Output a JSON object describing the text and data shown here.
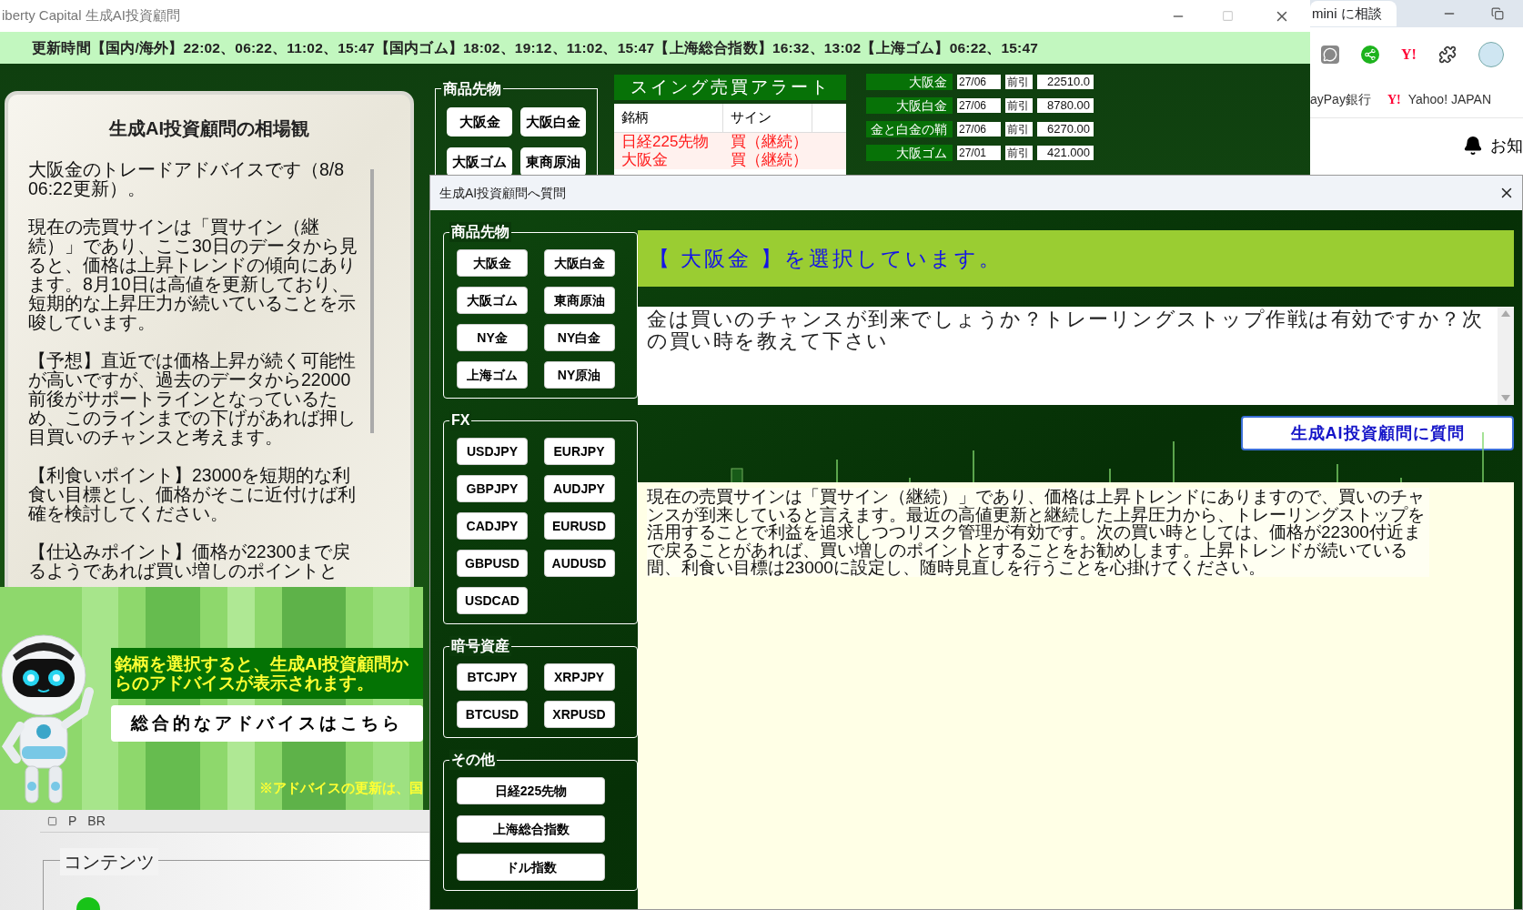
{
  "main_window": {
    "title": "iberty Capital 生成AI投資顧問",
    "update_bar": "更新時間【国内/海外】22:02、06:22、11:02、15:47【国内ゴム】18:02、19:12、11:02、15:47【上海総合指数】16:32、13:02【上海ゴム】06:22、15:47",
    "outlook": {
      "title": "生成AI投資顧問の相場観",
      "paragraphs": [
        "大阪金のトレードアドバイスです（8/8 06:22更新）。",
        "現在の売買サインは「買サイン（継続）」であり、ここ30日のデータから見ると、価格は上昇トレンドの傾向にあります。8月10日は高値を更新しており、短期的な上昇圧力が続いていることを示唆しています。",
        "【予想】直近では価格上昇が続く可能性が高いですが、過去のデータから22000前後がサポートラインとなっているため、このラインまでの下げがあれば押し目買いのチャンスと考えます。",
        "【利食いポイント】23000を短期的な利食い目標とし、価格がそこに近付けば利確を検討してください。",
        "【仕込みポイント】価格が22300まで戻るようであれば買い増しのポイントと"
      ]
    },
    "futures_group": {
      "legend": "商品先物",
      "buttons": [
        "大阪金",
        "大阪白金",
        "大阪ゴム",
        "東商原油"
      ]
    },
    "swing_alert": {
      "title": "スイング売買アラート",
      "columns": [
        "銘柄",
        "サイン"
      ],
      "rows": [
        {
          "name": "日経225先物",
          "sign": "買（継続）"
        },
        {
          "name": "大阪金",
          "sign": "買（継続）"
        }
      ]
    },
    "prices": [
      {
        "name": "大阪金",
        "date": "27/06",
        "session": "前引",
        "value": "22510.0"
      },
      {
        "name": "大阪白金",
        "date": "27/06",
        "session": "前引",
        "value": "8780.00"
      },
      {
        "name": "金と白金の鞘",
        "date": "27/06",
        "session": "前引",
        "value": "6270.00"
      },
      {
        "name": "大阪ゴム",
        "date": "27/01",
        "session": "前引",
        "value": "421.000"
      }
    ],
    "robot_message": "銘柄を選択すると、生成AI投資顧問からのアドバイスが表示されます。",
    "overall_button": "総合的なアドバイスはこちら",
    "note": "※アドバイスの更新は、国"
  },
  "dialog": {
    "title": "生成AI投資顧問へ質問",
    "groups": [
      {
        "legend": "商品先物",
        "kind": "grid",
        "buttons": [
          "大阪金",
          "大阪白金",
          "大阪ゴム",
          "東商原油",
          "NY金",
          "NY白金",
          "上海ゴム",
          "NY原油"
        ]
      },
      {
        "legend": "FX",
        "kind": "grid",
        "buttons": [
          "USDJPY",
          "EURJPY",
          "GBPJPY",
          "AUDJPY",
          "CADJPY",
          "EURUSD",
          "GBPUSD",
          "AUDUSD",
          "USDCAD"
        ]
      },
      {
        "legend": "暗号資産",
        "kind": "grid",
        "buttons": [
          "BTCJPY",
          "XRPJPY",
          "BTCUSD",
          "XRPUSD"
        ]
      },
      {
        "legend": "その他",
        "kind": "wide",
        "buttons": [
          "日経225先物",
          "上海総合指数",
          "ドル指数"
        ]
      }
    ],
    "selected_banner": "【 大阪金 】を選択しています。",
    "question": "金は買いのチャンスが到来でしょうか？トレーリングストップ作戦は有効ですか？次の買い時を教えて下さい",
    "ask_button": "生成AI投資顧問に質問",
    "answer": "現在の売買サインは「買サイン（継続）」であり、価格は上昇トレンドにありますので、買いのチャンスが到来していると言えます。最近の高値更新と継続した上昇圧力から、トレーリングストップを活用することで利益を追求しつつリスク管理が有効です。次の買い時としては、価格が22300付近まで戻ることがあれば、買い増しのポイントとすることをお勧めします。上昇トレンドが続いている間、利食い目標は23000に設定し、随時見直しを行うことを心掛けてください。"
  },
  "browser": {
    "tab": "mini に相談",
    "toolbar_logo": "Y!",
    "bookmarks": [
      {
        "label": "ayPay銀行"
      },
      {
        "logo": "Y!",
        "label": "Yahoo! JAPAN"
      }
    ],
    "notice": "お知"
  },
  "bottom_window": {
    "toolbar": [
      "P",
      "BR"
    ],
    "fieldset": "コンテンツ"
  }
}
